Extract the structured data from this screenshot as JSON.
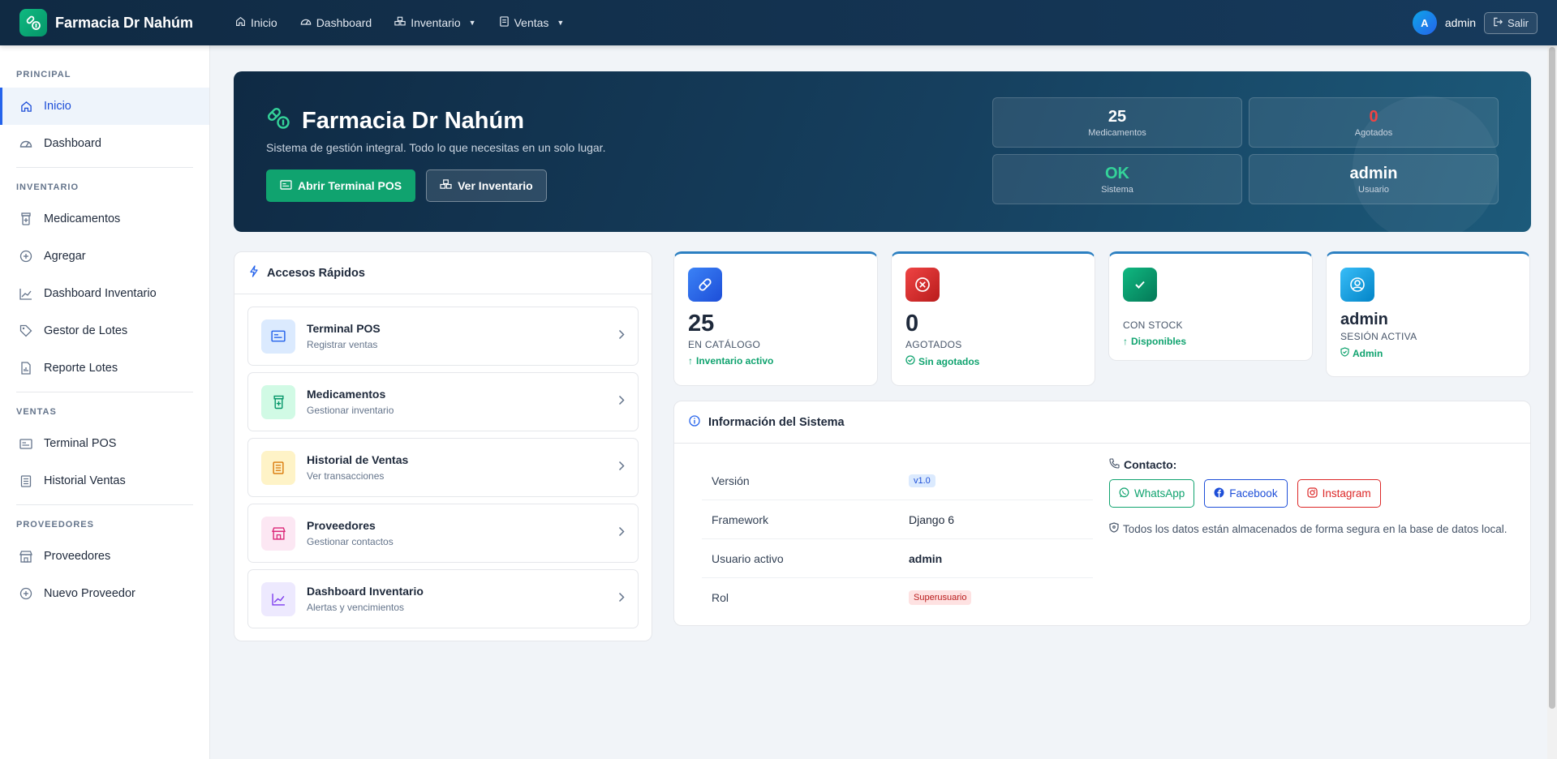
{
  "brand": {
    "name": "Farmacia Dr Nahúm"
  },
  "nav": {
    "items": [
      {
        "label": "Inicio",
        "icon": "home-icon"
      },
      {
        "label": "Dashboard",
        "icon": "gauge-icon"
      },
      {
        "label": "Inventario",
        "icon": "boxes-icon",
        "dropdown": true
      },
      {
        "label": "Ventas",
        "icon": "receipt-icon",
        "dropdown": true
      }
    ],
    "user_initial": "A",
    "username": "admin",
    "logout_label": "Salir"
  },
  "sidebar": {
    "sections": [
      {
        "title": "PRINCIPAL",
        "items": [
          {
            "label": "Inicio",
            "active": true
          },
          {
            "label": "Dashboard"
          }
        ]
      },
      {
        "title": "INVENTARIO",
        "items": [
          {
            "label": "Medicamentos"
          },
          {
            "label": "Agregar"
          },
          {
            "label": "Dashboard Inventario"
          },
          {
            "label": "Gestor de Lotes"
          },
          {
            "label": "Reporte Lotes"
          }
        ]
      },
      {
        "title": "VENTAS",
        "items": [
          {
            "label": "Terminal POS"
          },
          {
            "label": "Historial Ventas"
          }
        ]
      },
      {
        "title": "PROVEEDORES",
        "items": [
          {
            "label": "Proveedores"
          },
          {
            "label": "Nuevo Proveedor"
          }
        ]
      }
    ]
  },
  "hero": {
    "title": "Farmacia Dr Nahúm",
    "subtitle": "Sistema de gestión integral. Todo lo que necesitas en un solo lugar.",
    "primary_button": "Abrir Terminal POS",
    "secondary_button": "Ver Inventario",
    "stats": [
      {
        "value": "25",
        "label": "Medicamentos"
      },
      {
        "value": "0",
        "label": "Agotados"
      },
      {
        "value": "OK",
        "label": "Sistema"
      },
      {
        "value": "admin",
        "label": "Usuario"
      }
    ]
  },
  "quick": {
    "title": "Accesos Rápidos",
    "items": [
      {
        "title": "Terminal POS",
        "subtitle": "Registrar ventas"
      },
      {
        "title": "Medicamentos",
        "subtitle": "Gestionar inventario"
      },
      {
        "title": "Historial de Ventas",
        "subtitle": "Ver transacciones"
      },
      {
        "title": "Proveedores",
        "subtitle": "Gestionar contactos"
      },
      {
        "title": "Dashboard Inventario",
        "subtitle": "Alertas y vencimientos"
      }
    ]
  },
  "stats": [
    {
      "value": "25",
      "label": "EN CATÁLOGO",
      "foot": "Inventario activo"
    },
    {
      "value": "0",
      "label": "AGOTADOS",
      "foot": "Sin agotados"
    },
    {
      "value": "",
      "label": "CON STOCK",
      "foot": "Disponibles"
    },
    {
      "value": "admin",
      "label": "SESIÓN ACTIVA",
      "foot": "Admin"
    }
  ],
  "system": {
    "title": "Información del Sistema",
    "rows": [
      {
        "key": "Versión",
        "value": "v1.0"
      },
      {
        "key": "Framework",
        "value": "Django 6"
      },
      {
        "key": "Usuario activo",
        "value": "admin"
      },
      {
        "key": "Rol",
        "value": "Superusuario"
      }
    ],
    "contact_label": "Contacto:",
    "social": [
      "WhatsApp",
      "Facebook",
      "Instagram"
    ],
    "secure_note": "Todos los datos están almacenados de forma segura en la base de datos local."
  },
  "colors": {
    "navbar": "#102a43",
    "accent_green": "#10a36f",
    "accent_blue": "#2563eb",
    "danger": "#ef4444"
  }
}
